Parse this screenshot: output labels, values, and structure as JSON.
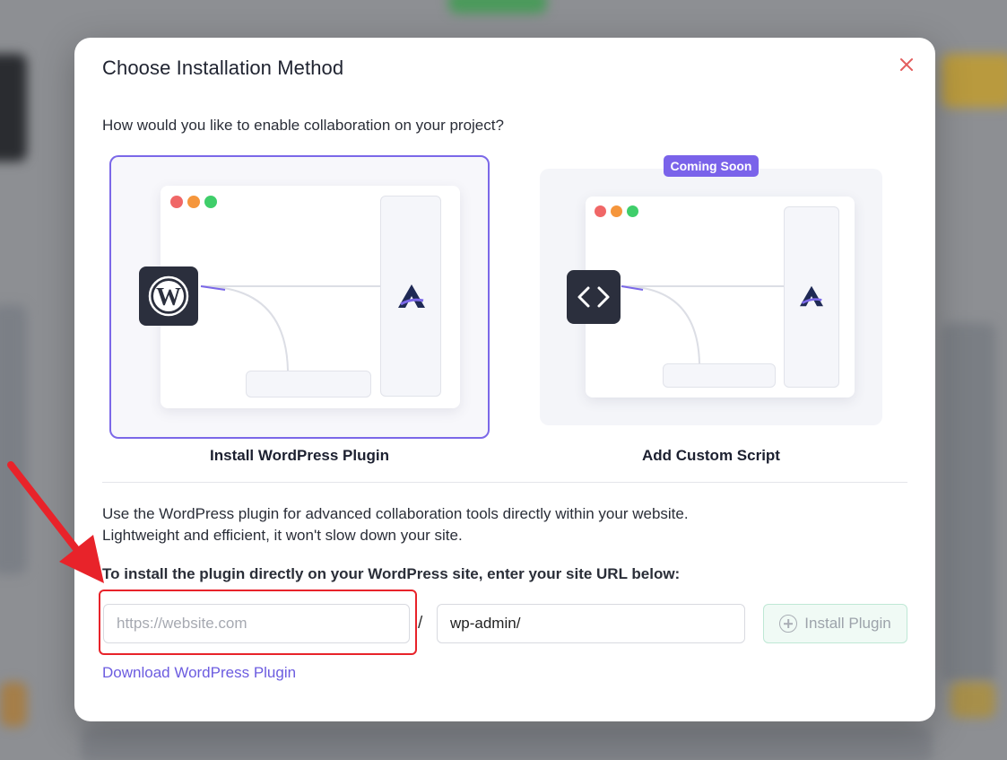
{
  "modal": {
    "title": "Choose Installation Method",
    "question": "How would you like to enable collaboration on your project?",
    "options": [
      {
        "label": "Install WordPress Plugin",
        "selected": true,
        "icon": "wordpress-icon"
      },
      {
        "label": "Add Custom Script",
        "selected": false,
        "icon": "code-icon",
        "badge": "Coming Soon"
      }
    ],
    "description_line1": "Use the WordPress plugin for advanced collaboration tools directly within your website.",
    "description_line2": "Lightweight and efficient, it won't slow down your site.",
    "instruction": "To install the plugin directly on your WordPress site, enter your site URL below:",
    "url_input": {
      "placeholder": "https://website.com",
      "value": ""
    },
    "separator": "/",
    "path_input": {
      "value": "wp-admin/"
    },
    "install_button": {
      "label": "Install Plugin",
      "icon": "plus-circle-icon",
      "disabled": true
    },
    "download_link": "Download WordPress Plugin"
  },
  "colors": {
    "accent": "#7b68e8",
    "badge": "#7a63ea",
    "link": "#6c5ce0",
    "close": "#e35d5d",
    "annotation": "#e8232a"
  }
}
